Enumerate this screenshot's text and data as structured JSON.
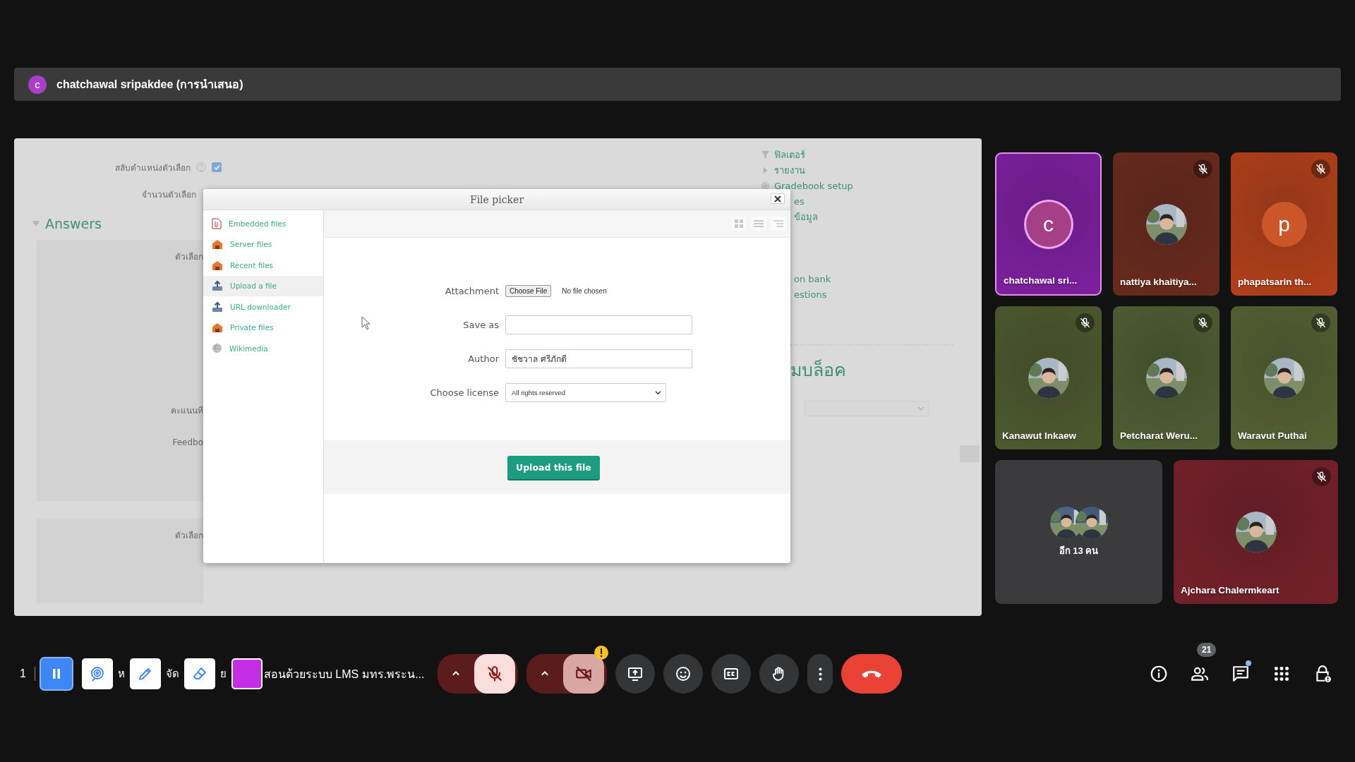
{
  "presenter_bar": {
    "initial": "c",
    "title": "chatchawal sripakdee (การนำเสนอ)"
  },
  "shared_screen": {
    "form_rows": [
      {
        "text": "สลับตำแหน่งตัวเลือก",
        "kind": "checkbox",
        "checked": true
      },
      {
        "text": "จำนวนตัวเลือก",
        "kind": "plain"
      }
    ],
    "section_title": "Answers",
    "choice_panels": [
      {
        "labels": [
          "ตัวเลือก",
          "คะแนนที",
          "Feedbo"
        ]
      },
      {
        "labels": [
          "ตัวเลือก"
        ]
      }
    ],
    "nav_groups": [
      [
        {
          "text": "ฟิลเตอร์",
          "kind": "filter"
        },
        {
          "text": "รายงาน",
          "kind": "expand"
        },
        {
          "text": "Gradebook setup",
          "kind": "gear"
        },
        {
          "text": "es",
          "kind": "plain"
        },
        {
          "text": "ข้อมูล",
          "kind": "plain"
        }
      ],
      [
        {
          "text": "on bank",
          "kind": "plain"
        },
        {
          "text": "estions",
          "kind": "plain"
        }
      ]
    ],
    "block_heading": "มบล็อค",
    "file_picker": {
      "title": "File picker",
      "repositories": [
        {
          "label": "Embedded files",
          "kind": "document",
          "selected": false
        },
        {
          "label": "Server files",
          "kind": "folder",
          "selected": false
        },
        {
          "label": "Recent files",
          "kind": "folder",
          "selected": false
        },
        {
          "label": "Upload a file",
          "kind": "upload",
          "selected": true
        },
        {
          "label": "URL downloader",
          "kind": "upload",
          "selected": false
        },
        {
          "label": "Private files",
          "kind": "folder",
          "selected": false
        },
        {
          "label": "Wikimedia",
          "kind": "globe",
          "selected": false
        }
      ],
      "fields": [
        {
          "label": "Attachment",
          "kind": "file",
          "button": "Choose File",
          "status": "No file chosen"
        },
        {
          "label": "Save as",
          "kind": "text"
        },
        {
          "label": "Author",
          "kind": "text",
          "value": "ชัชวาล ศรีภักดี"
        },
        {
          "label": "Choose license",
          "kind": "select",
          "value": "All rights reserved"
        }
      ],
      "upload_button": "Upload this file"
    }
  },
  "tiles": [
    {
      "name": "chatchawal sri...",
      "kind": "initial",
      "initial": "c",
      "color": "#7e1fa0",
      "muted": false,
      "speaking": true
    },
    {
      "name": "nattiya khaitiya...",
      "color": "#6a2a1e",
      "muted": true,
      "speaking": false
    },
    {
      "name": "phapatsarin th...",
      "kind": "initial",
      "initial": "p",
      "color": "#b3401a",
      "muted": true,
      "speaking": false
    },
    {
      "name": "Kanawut Inkaew",
      "color": "#4d5a2e",
      "muted": true,
      "speaking": false
    },
    {
      "name": "Petcharat Weru...",
      "color": "#4f5d33",
      "muted": true,
      "speaking": false
    },
    {
      "name": "Waravut Puthai",
      "color": "#556133",
      "muted": true,
      "speaking": false
    }
  ],
  "more_tile": {
    "label": "อีก 13 คน"
  },
  "last_tile": {
    "name": "Ajchara Chalermkeart",
    "color": "#75202a",
    "muted": true,
    "speaking": false
  },
  "toolbar": {
    "meeting_index": "1",
    "annotation_tools": [
      {
        "kind": "pause",
        "selected": true
      },
      {
        "kind": "laser",
        "selected": false,
        "after": "ห"
      },
      {
        "kind": "pen",
        "selected": false,
        "after": "จัด"
      },
      {
        "kind": "eraser",
        "selected": false,
        "after": "ย"
      },
      {
        "kind": "color",
        "color": "#c52ee6"
      }
    ],
    "meeting_title": "สอนด้วยระบบ LMS มทร.พระน...",
    "controls": [
      {
        "kind": "mic",
        "on": false
      },
      {
        "kind": "camera",
        "on": false,
        "warning": true
      },
      {
        "kind": "present"
      },
      {
        "kind": "reactions"
      },
      {
        "kind": "captions"
      },
      {
        "kind": "raise_hand"
      },
      {
        "kind": "more"
      },
      {
        "kind": "leave"
      }
    ],
    "side_buttons": [
      {
        "kind": "info"
      },
      {
        "kind": "people",
        "badge": "21"
      },
      {
        "kind": "chat",
        "unread": true
      },
      {
        "kind": "activities"
      },
      {
        "kind": "host_controls"
      }
    ]
  }
}
